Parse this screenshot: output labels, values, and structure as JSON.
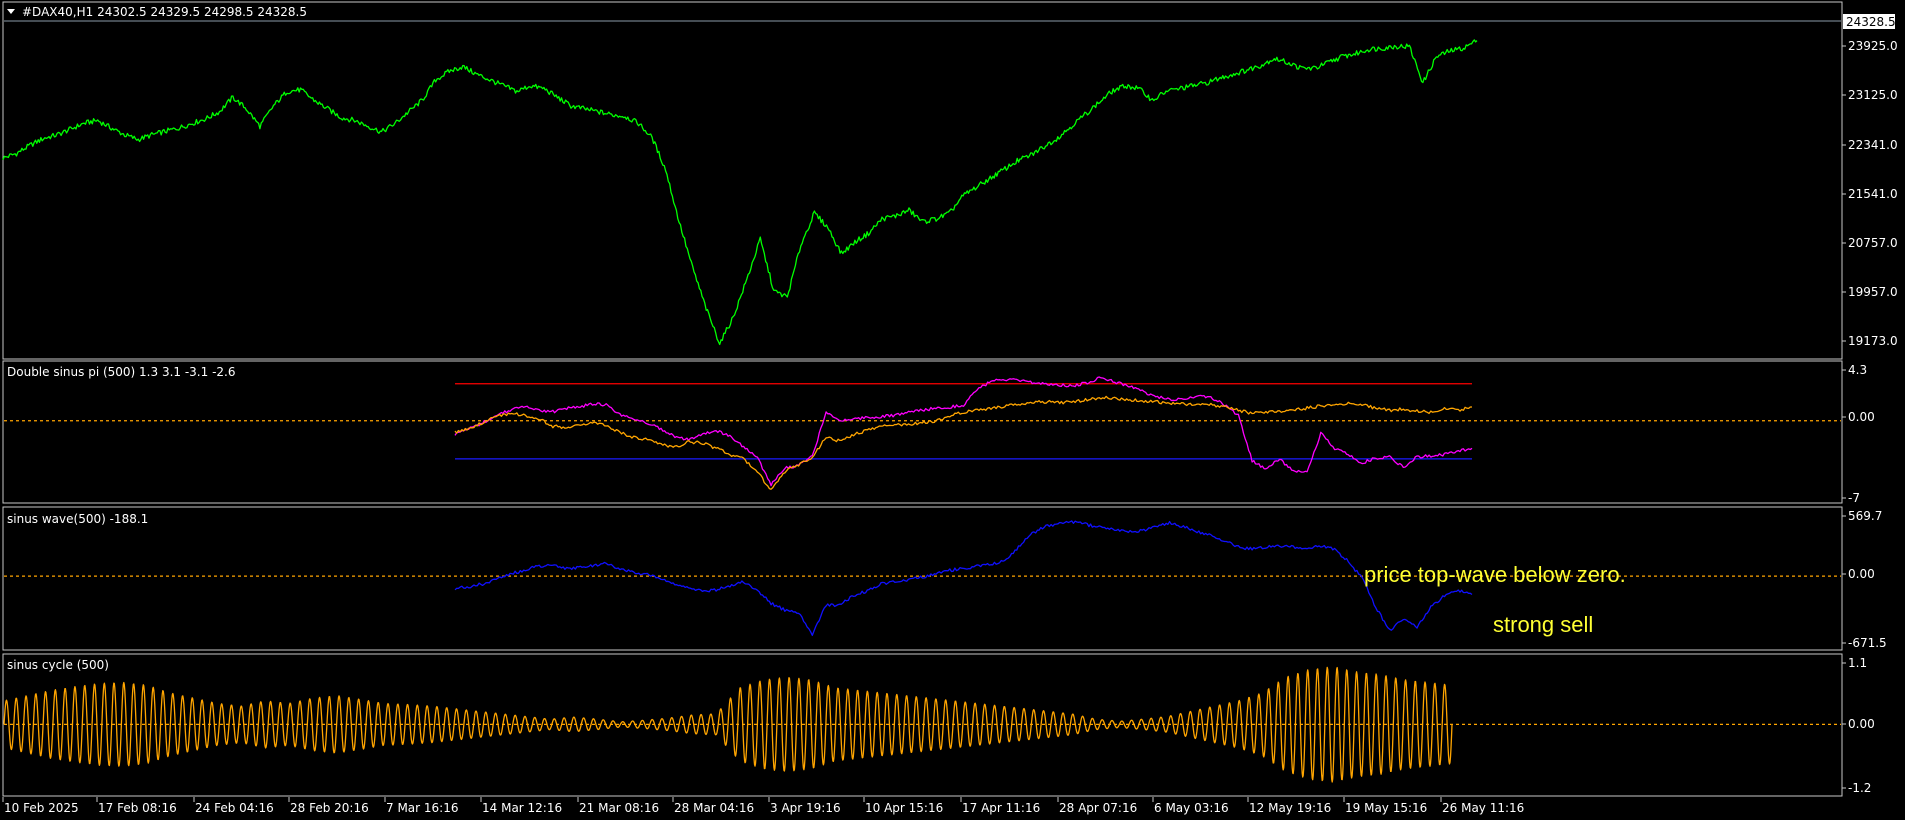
{
  "colors": {
    "background": "#000000",
    "frame": "#c8c8c8",
    "text": "#ffffff",
    "price": "#00ff00",
    "magenta": "#ff00ff",
    "orange": "#ffa500",
    "red": "#ff0000",
    "blue": "#1a1aff",
    "wave": "#1010ff",
    "annotation": "#ffff33"
  },
  "x_axis_labels": [
    "10 Feb 2025",
    "17 Feb 08:16",
    "24 Feb 04:16",
    "28 Feb 20:16",
    "7 Mar 16:16",
    "14 Mar 12:16",
    "21 Mar 08:16",
    "28 Mar 04:16",
    "3 Apr 19:16",
    "10 Apr 15:16",
    "17 Apr 11:16",
    "28 Apr 07:16",
    "6 May 03:16",
    "12 May 19:16",
    "19 May 15:16",
    "26 May 11:16"
  ],
  "chart_data": [
    {
      "type": "line",
      "title": "#DAX40,H1  24302.5 24329.5 24298.5 24328.5",
      "current_value_label": "24328.5",
      "yticks": [
        "23925.0",
        "23125.0",
        "22341.0",
        "21541.0",
        "20757.0",
        "19957.0",
        "19173.0"
      ],
      "ylim": [
        18950,
        24650
      ],
      "series": [
        {
          "values": [
            22300,
            22380,
            22520,
            22640,
            22700,
            22800,
            22900,
            22950,
            22820,
            22700,
            22620,
            22700,
            22760,
            22820,
            22900,
            22980,
            23100,
            23350,
            23150,
            22850,
            23200,
            23450,
            23480,
            23300,
            23150,
            23000,
            22950,
            22850,
            22750,
            22900,
            23100,
            23300,
            23650,
            23800,
            23880,
            23750,
            23650,
            23550,
            23450,
            23550,
            23500,
            23350,
            23200,
            23150,
            23100,
            23050,
            23020,
            22900,
            22650,
            22100,
            21200,
            20400,
            19700,
            19100,
            19550,
            20200,
            20900,
            20000,
            19900,
            20800,
            21350,
            21100,
            20650,
            20850,
            21000,
            21250,
            21300,
            21400,
            21200,
            21250,
            21350,
            21650,
            21800,
            21950,
            22100,
            22250,
            22350,
            22500,
            22650,
            22850,
            23050,
            23250,
            23450,
            23550,
            23500,
            23300,
            23450,
            23500,
            23550,
            23600,
            23680,
            23750,
            23820,
            23900,
            24020,
            23950,
            23850,
            23850,
            23950,
            24050,
            24100,
            24180,
            24200,
            24230,
            24230,
            23600,
            24050,
            24150,
            24200,
            24328.5
          ]
        }
      ]
    },
    {
      "type": "line",
      "title": "Double sinus pi (500) 1.3 3.1 -3.1 -2.6",
      "yticks": [
        "4.3",
        "0.00",
        "-7"
      ],
      "ylim": [
        -7.3,
        4.8
      ],
      "reference_lines": [
        {
          "value": 3.5,
          "color": "#ff0000"
        },
        {
          "value": -3.6,
          "color": "#1a1aff"
        },
        {
          "value": 0,
          "color": "#ffa500",
          "dashed": true
        }
      ],
      "series": [
        {
          "color": "#ff00ff",
          "values": [
            -1.3,
            -0.8,
            -0.2,
            0.5,
            1.0,
            1.3,
            1.1,
            0.8,
            1.2,
            1.3,
            1.6,
            1.5,
            0.6,
            0.2,
            -0.2,
            -0.8,
            -1.5,
            -1.8,
            -1.2,
            -0.9,
            -1.5,
            -2.5,
            -3.5,
            -6.0,
            -4.5,
            -4.2,
            -3.4,
            0.9,
            0.0,
            0.2,
            0.3,
            0.4,
            0.5,
            0.8,
            1.0,
            1.2,
            1.3,
            1.5,
            3.0,
            3.7,
            3.9,
            3.8,
            3.6,
            3.5,
            3.4,
            3.3,
            3.6,
            4.1,
            3.7,
            3.3,
            2.8,
            2.3,
            2.0,
            2.0,
            2.4,
            2.2,
            1.5,
            0.5,
            -3.8,
            -4.6,
            -3.6,
            -4.8,
            -4.9,
            -1.2,
            -2.6,
            -3.2,
            -4.0,
            -3.5,
            -3.4,
            -4.4,
            -3.4,
            -3.3,
            -3.2,
            -2.9,
            -2.6
          ]
        },
        {
          "color": "#ffa500",
          "values": [
            -1.1,
            -0.7,
            -0.2,
            0.4,
            0.7,
            0.5,
            0.3,
            -0.5,
            -0.6,
            -0.4,
            -0.1,
            -0.5,
            -1.1,
            -1.6,
            -1.8,
            -2.2,
            -2.5,
            -2.0,
            -2.1,
            -2.6,
            -3.2,
            -3.6,
            -4.8,
            -6.6,
            -4.8,
            -4.2,
            -3.4,
            -1.6,
            -1.9,
            -1.3,
            -0.9,
            -0.5,
            -0.4,
            -0.3,
            -0.2,
            0.0,
            0.5,
            0.8,
            1.0,
            1.2,
            1.4,
            1.6,
            1.7,
            1.8,
            1.7,
            1.8,
            2.0,
            2.2,
            2.1,
            2.0,
            1.9,
            1.8,
            1.6,
            1.6,
            1.5,
            1.5,
            1.3,
            1.0,
            0.7,
            0.8,
            0.9,
            1.0,
            1.2,
            1.4,
            1.5,
            1.6,
            1.5,
            1.2,
            1.0,
            1.1,
            0.9,
            0.8,
            1.2,
            1.0,
            1.3
          ]
        }
      ]
    },
    {
      "type": "line",
      "title": "sinus wave(500) -188.1",
      "yticks": [
        "569.7",
        "0.00",
        "-671.5"
      ],
      "ylim": [
        -700,
        620
      ],
      "reference_lines": [
        {
          "value": 0,
          "color": "#ffa500",
          "dashed": true
        }
      ],
      "series": [
        {
          "color": "#1010ff",
          "values": [
            -130,
            -110,
            -80,
            -30,
            20,
            60,
            100,
            110,
            80,
            90,
            110,
            130,
            80,
            40,
            20,
            -20,
            -80,
            -130,
            -150,
            -140,
            -100,
            -60,
            -150,
            -280,
            -350,
            -380,
            -600,
            -300,
            -300,
            -200,
            -150,
            -80,
            -60,
            -40,
            -10,
            20,
            60,
            80,
            100,
            120,
            160,
            300,
            440,
            520,
            540,
            560,
            530,
            500,
            480,
            460,
            470,
            520,
            550,
            510,
            460,
            420,
            360,
            300,
            280,
            300,
            310,
            300,
            290,
            310,
            280,
            150,
            -20,
            -320,
            -560,
            -440,
            -520,
            -320,
            -200,
            -150,
            -190
          ]
        }
      ]
    },
    {
      "type": "line",
      "title": "sinus cycle (500)",
      "yticks": [
        "1.1",
        "0.00",
        "-1.2"
      ],
      "ylim": [
        -1.25,
        1.15
      ],
      "reference_lines": [
        {
          "value": 0,
          "color": "#ffa500",
          "dashed": true
        }
      ],
      "series": [
        {
          "color": "#ffa500",
          "amplitude_envelope": [
            0.45,
            0.55,
            0.65,
            0.72,
            0.78,
            0.8,
            0.75,
            0.6,
            0.5,
            0.4,
            0.35,
            0.45,
            0.4,
            0.5,
            0.55,
            0.48,
            0.4,
            0.38,
            0.35,
            0.3,
            0.25,
            0.2,
            0.15,
            0.1,
            0.14,
            0.1,
            0.05,
            0.08,
            0.12,
            0.18,
            0.2,
            0.7,
            0.85,
            0.9,
            0.85,
            0.7,
            0.65,
            0.6,
            0.55,
            0.5,
            0.45,
            0.4,
            0.35,
            0.3,
            0.25,
            0.2,
            0.1,
            0.06,
            0.1,
            0.15,
            0.25,
            0.35,
            0.45,
            0.6,
            0.9,
            1.05,
            1.1,
            1.0,
            0.95,
            0.85,
            0.8,
            0.75
          ]
        }
      ]
    }
  ],
  "annotations": [
    "price top-wave below zero.",
    "strong sell"
  ]
}
